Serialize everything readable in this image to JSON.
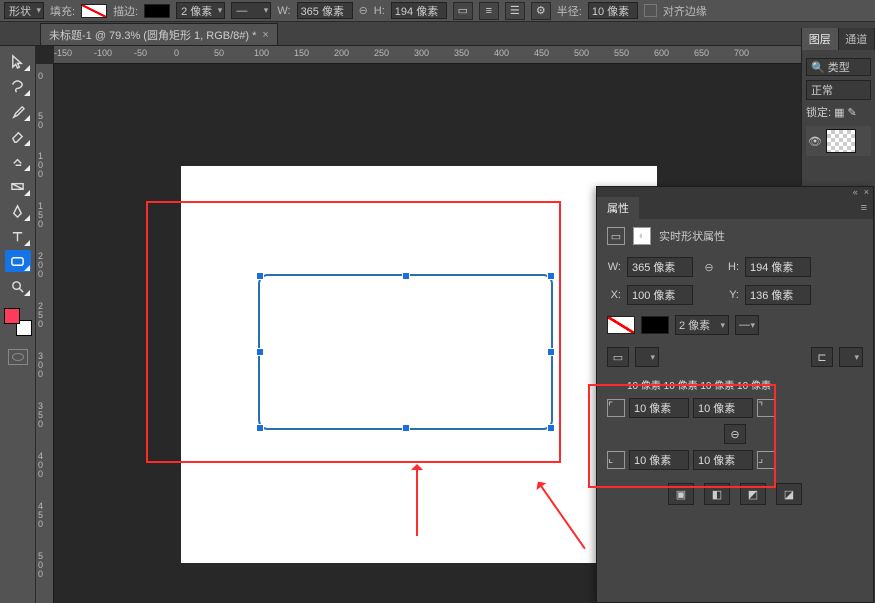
{
  "options_bar": {
    "shape_label": "形状",
    "fill_label": "填充:",
    "stroke_label": "描边:",
    "stroke_width": "2 像素",
    "w_label": "W:",
    "w_value": "365 像素",
    "h_label": "H:",
    "h_value": "194 像素",
    "radius_label": "半径:",
    "radius_value": "10 像素",
    "align_edges": "对齐边缘"
  },
  "tab": {
    "title": "未标题-1 @ 79.3% (圆角矩形 1, RGB/8#) *"
  },
  "ruler_h": [
    "-150",
    "-100",
    "-50",
    "0",
    "50",
    "100",
    "150",
    "200",
    "250",
    "300",
    "350",
    "400",
    "450",
    "500",
    "550",
    "600",
    "650",
    "700"
  ],
  "ruler_v_vals": [
    "0",
    "50",
    "100",
    "150",
    "200",
    "250",
    "300",
    "350",
    "400",
    "450",
    "500"
  ],
  "layers": {
    "tab_layer": "图层",
    "tab_channel": "通道",
    "search_label": "类型",
    "blend": "正常",
    "lock_label": "锁定:"
  },
  "props": {
    "title": "属性",
    "heading": "实时形状属性",
    "W": "W:",
    "H": "H:",
    "X": "X:",
    "Y": "Y:",
    "w_val": "365 像素",
    "h_val": "194 像素",
    "x_val": "100 像素",
    "y_val": "136 像素",
    "stroke_w": "2 像素",
    "corner_top": "10 像素 10 像素 10 像素 10 像素",
    "c1": "10 像素",
    "c2": "10 像素",
    "c3": "10 像素",
    "c4": "10 像素",
    "link": "⊖"
  },
  "chart_data": null
}
